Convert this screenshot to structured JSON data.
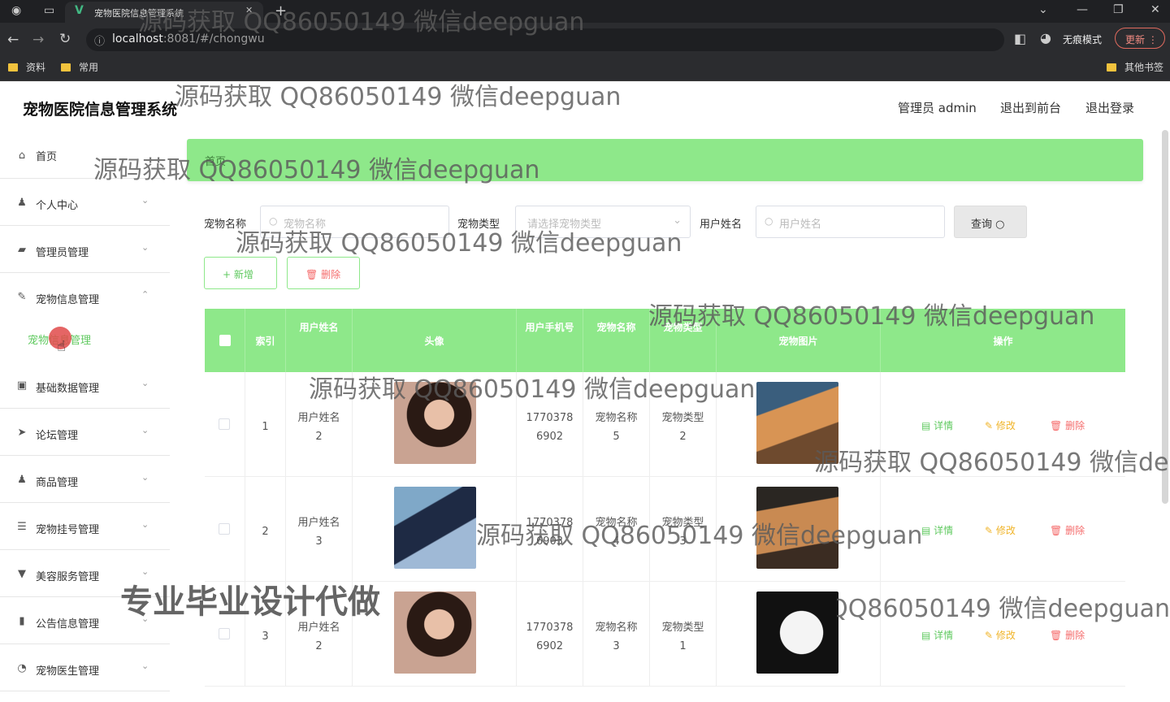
{
  "browser": {
    "tab_title": "宠物医院信息管理系统",
    "url_host": "localhost",
    "url_rest": ":8081/#/chongwu",
    "incognito_label": "无痕模式",
    "update_label": "更新",
    "bookmarks": [
      "资料",
      "常用"
    ],
    "other_bookmarks": "其他书签"
  },
  "app": {
    "title": "宠物医院信息管理系统",
    "admin_label": "管理员 admin",
    "to_front": "退出到前台",
    "logout": "退出登录"
  },
  "sidebar": {
    "items": [
      {
        "label": "首页",
        "icon": "home-icon",
        "glyph": "⌂"
      },
      {
        "label": "个人中心",
        "icon": "user-icon",
        "glyph": "♟"
      },
      {
        "label": "管理员管理",
        "icon": "admin-icon",
        "glyph": "▰"
      },
      {
        "label": "宠物信息管理",
        "icon": "pet-icon",
        "glyph": "✎"
      },
      {
        "label": "基础数据管理",
        "icon": "data-icon",
        "glyph": "▣"
      },
      {
        "label": "论坛管理",
        "icon": "forum-icon",
        "glyph": "➤"
      },
      {
        "label": "商品管理",
        "icon": "goods-icon",
        "glyph": "♟"
      },
      {
        "label": "宠物挂号管理",
        "icon": "register-icon",
        "glyph": "☰"
      },
      {
        "label": "美容服务管理",
        "icon": "beauty-icon",
        "glyph": "▼"
      },
      {
        "label": "公告信息管理",
        "icon": "notice-icon",
        "glyph": "▮"
      },
      {
        "label": "宠物医生管理",
        "icon": "doctor-icon",
        "glyph": "◔"
      }
    ],
    "submenu_label": "宠物信息管理"
  },
  "breadcrumb": "首页",
  "filters": {
    "pet_name_label": "宠物名称",
    "pet_name_placeholder": "宠物名称",
    "pet_type_label": "宠物类型",
    "pet_type_placeholder": "请选择宠物类型",
    "user_name_label": "用户姓名",
    "user_name_placeholder": "用户姓名",
    "query_label": "查询"
  },
  "actions": {
    "add": "+ 新增",
    "delete": "删除"
  },
  "table": {
    "headers": [
      "索引",
      "用户姓名",
      "头像",
      "用户手机号",
      "宠物名称",
      "宠物类型",
      "宠物图片",
      "操作"
    ],
    "rows": [
      {
        "index": "1",
        "user": "用户姓名 2",
        "phone": "1770378 6902",
        "pet": "宠物名称 5",
        "type": "宠物类型 2"
      },
      {
        "index": "2",
        "user": "用户姓名 3",
        "phone": "1770378 6903",
        "pet": "宠物名称 4",
        "type": "宠物类型 3"
      },
      {
        "index": "3",
        "user": "用户姓名 2",
        "phone": "1770378 6902",
        "pet": "宠物名称 3",
        "type": "宠物类型 1"
      }
    ],
    "op_detail": "详情",
    "op_edit": "修改",
    "op_delete": "删除"
  },
  "watermarks": {
    "text": "源码获取 QQ86050149 微信deepguan",
    "big": "专业毕业设计代做"
  },
  "colors": {
    "accent": "#8ee88a",
    "active_menu": "#5fc95f",
    "edit": "#f0b429",
    "delete": "#f56c6c",
    "detail": "#5fc95f"
  }
}
